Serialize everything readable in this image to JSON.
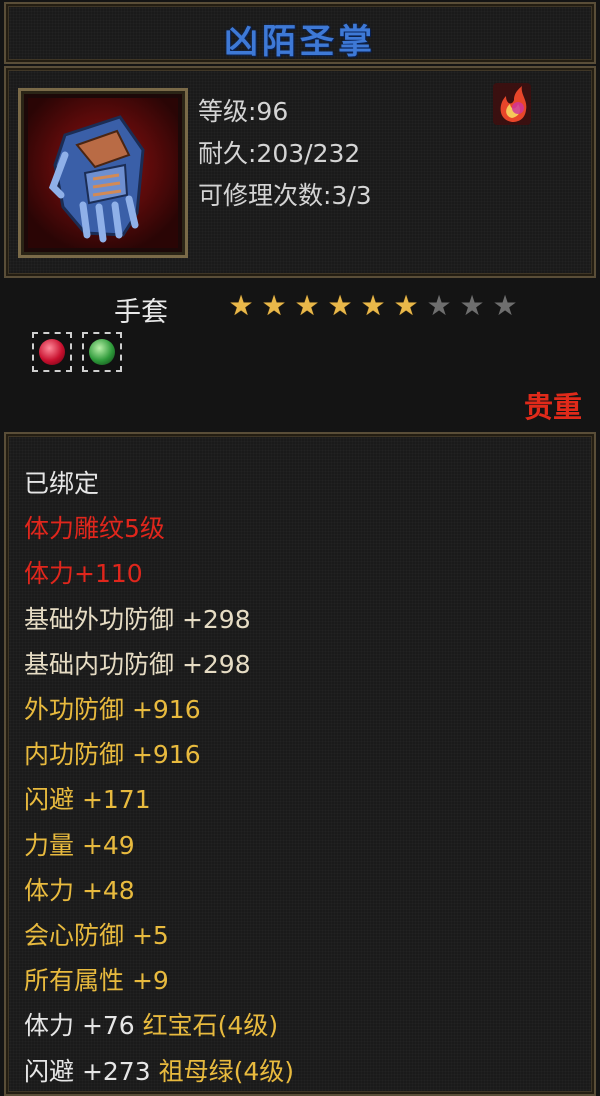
{
  "item": {
    "name": "凶陌圣掌",
    "level_label": "等级:96",
    "durability_label": "耐久:203/232",
    "repair_label": "可修理次数:3/3",
    "type": "手套",
    "stars": {
      "filled": 6,
      "total": 9
    },
    "rarity": "贵重"
  },
  "icons": {
    "item_icon": "blue-gauntlet-icon",
    "quality_icon": "flame-orb-icon",
    "gems": [
      "ruby-gem-icon",
      "emerald-gem-icon"
    ]
  },
  "colors": {
    "title": "#3e79d6",
    "white": "#e6e6e6",
    "red": "#e0261c",
    "cream": "#e6dcc4",
    "gold": "#e8ba3e",
    "star_gold": "#e9b84a",
    "star_grey": "#6e6e6e"
  },
  "attributes": [
    {
      "text": "已绑定",
      "color": "white"
    },
    {
      "text": "体力雕纹5级",
      "color": "red"
    },
    {
      "text": "体力+110",
      "color": "red"
    },
    {
      "text": "基础外功防御 +298",
      "color": "cream"
    },
    {
      "text": "基础内功防御 +298",
      "color": "cream"
    },
    {
      "text": "外功防御 +916",
      "color": "gold"
    },
    {
      "text": "内功防御 +916",
      "color": "gold"
    },
    {
      "text": "闪避 +171",
      "color": "gold"
    },
    {
      "text": "力量 +49",
      "color": "gold"
    },
    {
      "text": "体力 +48",
      "color": "gold"
    },
    {
      "text": "会心防御 +5",
      "color": "gold"
    },
    {
      "text": "所有属性 +9",
      "color": "gold"
    }
  ],
  "gem_lines": [
    {
      "stat": "体力 +76",
      "gem": "红宝石(4级)"
    },
    {
      "stat": "闪避 +273",
      "gem": "祖母绿(4级)"
    }
  ]
}
